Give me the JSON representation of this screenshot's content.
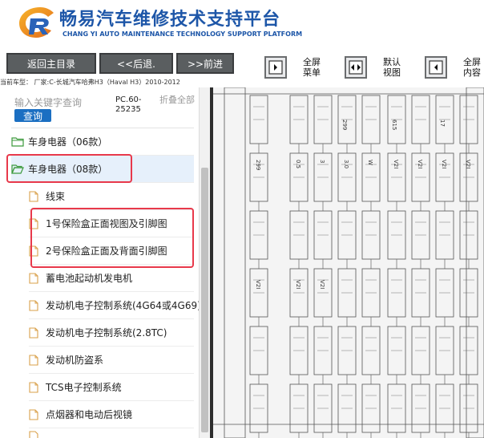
{
  "header": {
    "title_cn": "畅易汽车维修技术支持平台",
    "title_en": "CHANG YI AUTO MAINTENANCE TECHNOLOGY SUPPORT PLATFORM",
    "logo_letter": "C"
  },
  "toolbar": {
    "home_label": "返回主目录",
    "back_label": "<<后退.",
    "forward_label": ">>前进",
    "controls": [
      {
        "line1": "全屏",
        "line2": "菜单"
      },
      {
        "line1": "默认",
        "line2": "视图"
      },
      {
        "line1": "全屏",
        "line2": "内容"
      }
    ]
  },
  "car_info": "当前车型：  厂家:C-长城汽车哈弗H3（Haval H3）2010-2012",
  "search": {
    "placeholder": "输入关键字查询",
    "query_label": "查询",
    "code_text": "PC.60-25235",
    "fold_all": "折叠全部"
  },
  "tree": {
    "folders": [
      {
        "label": "车身电器（06款）"
      },
      {
        "label": "车身电器（08款）"
      }
    ],
    "documents": [
      {
        "label": "线束"
      },
      {
        "label": "1号保险盒正面视图及引脚图"
      },
      {
        "label": "2号保险盒正面及背面引脚图"
      },
      {
        "label": "蓄电池起动机发电机"
      },
      {
        "label": "发动机电子控制系统(4G64或4G69)"
      },
      {
        "label": "发动机电子控制系统(2.8TC)"
      },
      {
        "label": "发动机防盗系"
      },
      {
        "label": "TCS电子控制系统"
      },
      {
        "label": "点烟器和电动后视镜"
      }
    ]
  },
  "diagram": {
    "header_labels": [
      "299",
      "615",
      "17"
    ],
    "code_labels": [
      "299",
      "0.5",
      "3",
      "3.0",
      "W",
      "V2I",
      "V2I",
      "V2I",
      "V2I",
      "V2I",
      "V2I",
      "V2I"
    ]
  }
}
